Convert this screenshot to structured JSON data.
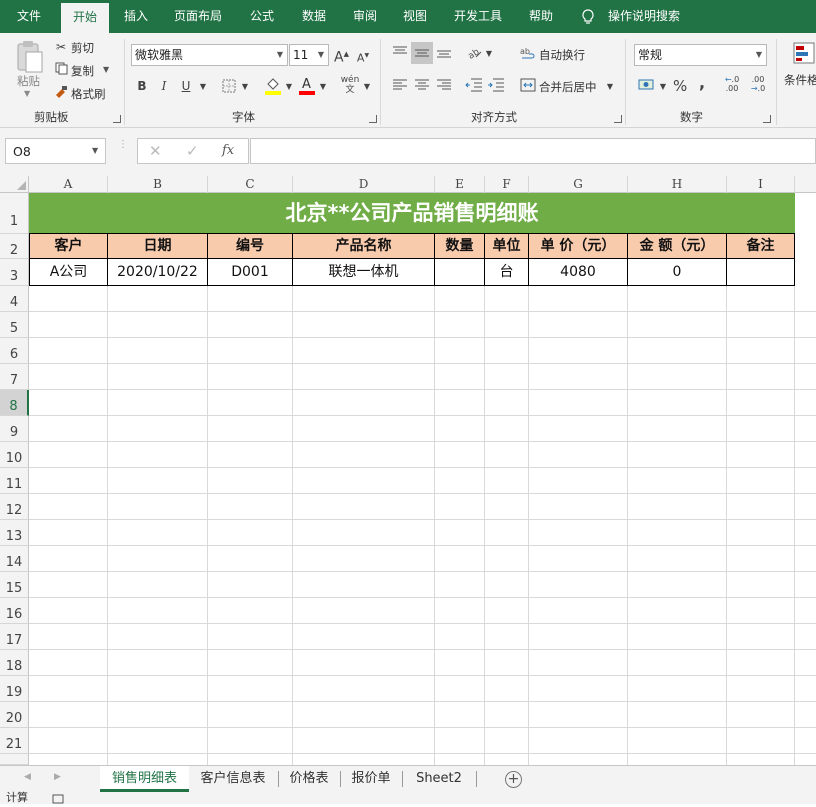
{
  "menu": {
    "items": [
      "文件",
      "开始",
      "插入",
      "页面布局",
      "公式",
      "数据",
      "审阅",
      "视图",
      "开发工具",
      "帮助"
    ],
    "active_index": 1,
    "tell_me": "操作说明搜索"
  },
  "ribbon": {
    "clipboard": {
      "paste": "粘贴",
      "cut": "剪切",
      "copy": "复制",
      "format_painter": "格式刷",
      "group_label": "剪贴板"
    },
    "font": {
      "font_name": "微软雅黑",
      "font_size": "11",
      "bold": "B",
      "italic": "I",
      "underline": "U",
      "group_label": "字体",
      "grow": "A",
      "shrink": "A"
    },
    "alignment": {
      "wrap_text": "自动换行",
      "merge_center": "合并后居中",
      "group_label": "对齐方式"
    },
    "number": {
      "format": "常规",
      "percent": "%",
      "comma": ",",
      "group_label": "数字",
      "inc_decimal": ".00",
      "dec_decimal": ".00"
    },
    "styles": {
      "conditional": "条件格"
    }
  },
  "formula_bar": {
    "name_box": "O8",
    "fx": "fx",
    "formula": ""
  },
  "grid": {
    "columns": [
      "A",
      "B",
      "C",
      "D",
      "E",
      "F",
      "G",
      "H",
      "I"
    ],
    "rows": [
      "1",
      "2",
      "3",
      "4",
      "5",
      "6",
      "7",
      "8",
      "9",
      "10",
      "11",
      "12",
      "13",
      "14",
      "15",
      "16",
      "17",
      "18",
      "19",
      "20",
      "21"
    ],
    "title": "北京**公司产品销售明细账",
    "headers": [
      "客户",
      "日期",
      "编号",
      "产品名称",
      "数量",
      "单位",
      "单 价（元）",
      "金 额（元）",
      "备注"
    ],
    "row3": [
      "A公司",
      "2020/10/22",
      "D001",
      "联想一体机",
      "",
      "台",
      "4080",
      "0",
      ""
    ],
    "colors": {
      "title_bg": "#70ad47",
      "header_bg": "#f8cbad",
      "accent": "#217346"
    }
  },
  "sheets": {
    "tabs": [
      "销售明细表",
      "客户信息表",
      "价格表",
      "报价单",
      "Sheet2"
    ],
    "active_index": 0
  },
  "status": {
    "text": "计算"
  }
}
